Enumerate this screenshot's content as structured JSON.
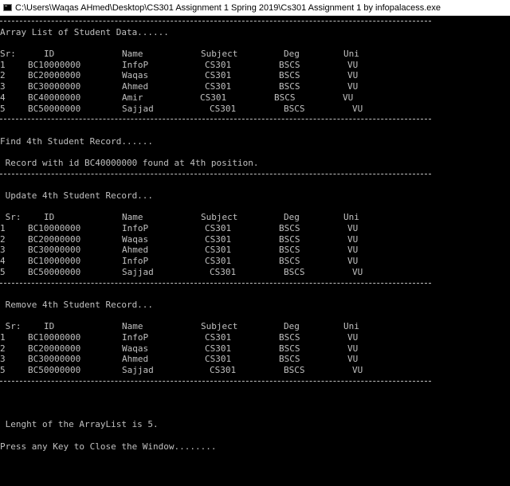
{
  "window": {
    "title": "C:\\Users\\Waqas AHmed\\Desktop\\CS301 Assignment 1 Spring 2019\\Cs301 Assignment 1 by infopalacess.exe",
    "icon": "console-app-icon"
  },
  "console": {
    "headings": {
      "array_list": "Array List of Student Data......",
      "find": "Find 4th Student Record......",
      "found_msg": " Record with id BC40000000 found at 4th position.",
      "update": " Update 4th Student Record...",
      "remove": " Remove 4th Student Record...",
      "length": " Lenght of the ArrayList is 5.",
      "close": "Press any Key to Close the Window........"
    },
    "header_row": {
      "sr": " Sr:",
      "id": "ID",
      "name": "Name",
      "subject": "Subject",
      "deg": "Deg",
      "uni": "Uni"
    },
    "header_row_initial": {
      "sr": "Sr:"
    },
    "table_initial": [
      {
        "sr": "1",
        "id": "BC10000000",
        "name": "InfoP",
        "subject": "CS301",
        "deg": "BSCS",
        "uni": "VU"
      },
      {
        "sr": "2",
        "id": "BC20000000",
        "name": "Waqas",
        "subject": "CS301",
        "deg": "BSCS",
        "uni": "VU"
      },
      {
        "sr": "3",
        "id": "BC30000000",
        "name": "Ahmed",
        "subject": "CS301",
        "deg": "BSCS",
        "uni": "VU"
      },
      {
        "sr": "4",
        "id": "BC40000000",
        "name": "Amir",
        "subject": "CS301",
        "deg": "BSCS",
        "uni": "VU"
      },
      {
        "sr": "5",
        "id": "BC50000000",
        "name": "Sajjad",
        "subject": "CS301",
        "deg": "BSCS",
        "uni": "VU"
      }
    ],
    "table_updated": [
      {
        "sr": "1",
        "id": "BC10000000",
        "name": "InfoP",
        "subject": "CS301",
        "deg": "BSCS",
        "uni": "VU"
      },
      {
        "sr": "2",
        "id": "BC20000000",
        "name": "Waqas",
        "subject": "CS301",
        "deg": "BSCS",
        "uni": "VU"
      },
      {
        "sr": "3",
        "id": "BC30000000",
        "name": "Ahmed",
        "subject": "CS301",
        "deg": "BSCS",
        "uni": "VU"
      },
      {
        "sr": "4",
        "id": "BC10000000",
        "name": "InfoP",
        "subject": "CS301",
        "deg": "BSCS",
        "uni": "VU"
      },
      {
        "sr": "5",
        "id": "BC50000000",
        "name": "Sajjad",
        "subject": "CS301",
        "deg": "BSCS",
        "uni": "VU"
      }
    ],
    "table_removed": [
      {
        "sr": "1",
        "id": "BC10000000",
        "name": "InfoP",
        "subject": "CS301",
        "deg": "BSCS",
        "uni": "VU"
      },
      {
        "sr": "2",
        "id": "BC20000000",
        "name": "Waqas",
        "subject": "CS301",
        "deg": "BSCS",
        "uni": "VU"
      },
      {
        "sr": "3",
        "id": "BC30000000",
        "name": "Ahmed",
        "subject": "CS301",
        "deg": "BSCS",
        "uni": "VU"
      },
      {
        "sr": "5",
        "id": "BC50000000",
        "name": "Sajjad",
        "subject": "CS301",
        "deg": "BSCS",
        "uni": "VU"
      }
    ]
  }
}
